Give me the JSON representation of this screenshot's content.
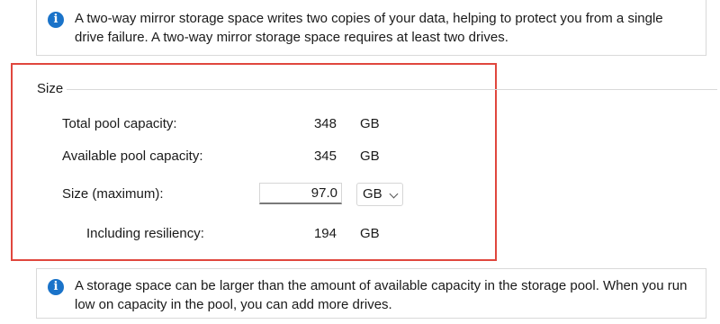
{
  "top_info": {
    "icon": "info-icon",
    "line1": "A two-way mirror storage space writes two copies of your data, helping to protect you from a single",
    "line2": "drive failure. A two-way mirror storage space requires at least two drives."
  },
  "size_group": {
    "title": "Size",
    "total_pool_capacity": {
      "label": "Total pool capacity:",
      "value": "348",
      "unit": "GB"
    },
    "available_pool_capacity": {
      "label": "Available pool capacity:",
      "value": "345",
      "unit": "GB"
    },
    "size_maximum": {
      "label": "Size (maximum):",
      "value": "97.0",
      "unit": "GB"
    },
    "including_resiliency": {
      "label": "Including resiliency:",
      "value": "194",
      "unit": "GB"
    }
  },
  "bottom_info": {
    "icon": "info-icon",
    "line1": "A storage space can be larger than the amount of available capacity in the storage pool. When you run",
    "line2": "low on capacity in the pool, you can add more drives."
  },
  "colors": {
    "highlight": "#e0473e",
    "info_icon": "#1a73c9"
  }
}
